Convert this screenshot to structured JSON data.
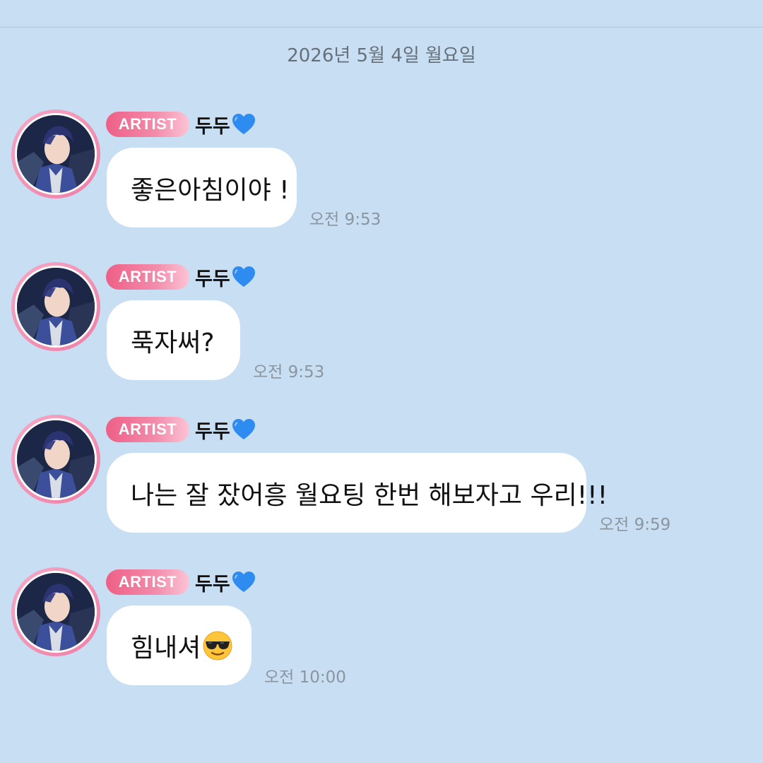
{
  "chat": {
    "date_label": "2026년 5월 4일 월요일",
    "messages": [
      {
        "badge": "ARTIST",
        "sender": "두두",
        "sender_icon": "blue-heart-icon",
        "text": "좋은아침이야 !",
        "time": "오전 9:53"
      },
      {
        "badge": "ARTIST",
        "sender": "두두",
        "sender_icon": "blue-heart-icon",
        "text": "푹자써?",
        "time": "오전 9:53"
      },
      {
        "badge": "ARTIST",
        "sender": "두두",
        "sender_icon": "blue-heart-icon",
        "text": "나는 잘 잤어흥 월요팅 한번 해보자고 우리!!!",
        "time": "오전 9:59"
      },
      {
        "badge": "ARTIST",
        "sender": "두두",
        "sender_icon": "blue-heart-icon",
        "text": "힘내셔",
        "text_emoji": "sunglasses-emoji",
        "time": "오전 10:00"
      }
    ]
  },
  "colors": {
    "background": "#c8def3",
    "bubble": "#ffffff",
    "badge_start": "#ee5f86",
    "badge_end": "#fbc4d5",
    "avatar_ring": "#f38cac",
    "heart": "#2e8cf0",
    "timestamp": "#8b95a0",
    "date_label": "#66707b"
  }
}
